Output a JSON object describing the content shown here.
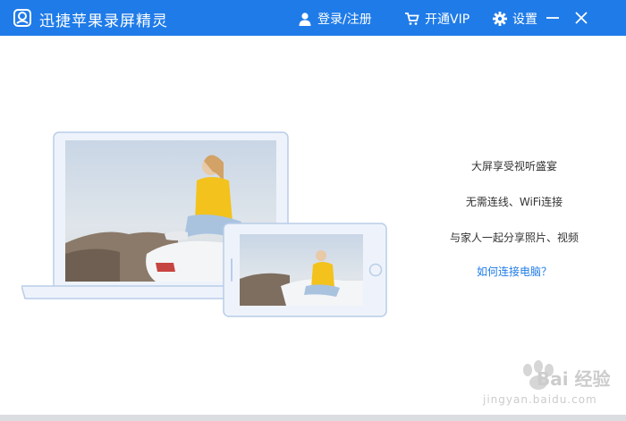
{
  "app": {
    "title": "迅捷苹果录屏精灵"
  },
  "header": {
    "login_label": "登录/注册",
    "vip_label": "开通VIP",
    "settings_label": "设置"
  },
  "features": [
    "大屏享受视听盛宴",
    "无需连线、WiFi连接",
    "与家人一起分享照片、视频"
  ],
  "help_link": "如何连接电脑？",
  "watermark": {
    "brand": "Bai 经验",
    "url": "jingyan.baidu.com"
  },
  "colors": {
    "primary": "#1f7be8",
    "device_border": "#b9cde8",
    "device_fill": "#eef3fb"
  },
  "icons": [
    "app-logo-icon",
    "user-icon",
    "cart-icon",
    "gear-icon",
    "minimize-icon",
    "close-icon"
  ]
}
